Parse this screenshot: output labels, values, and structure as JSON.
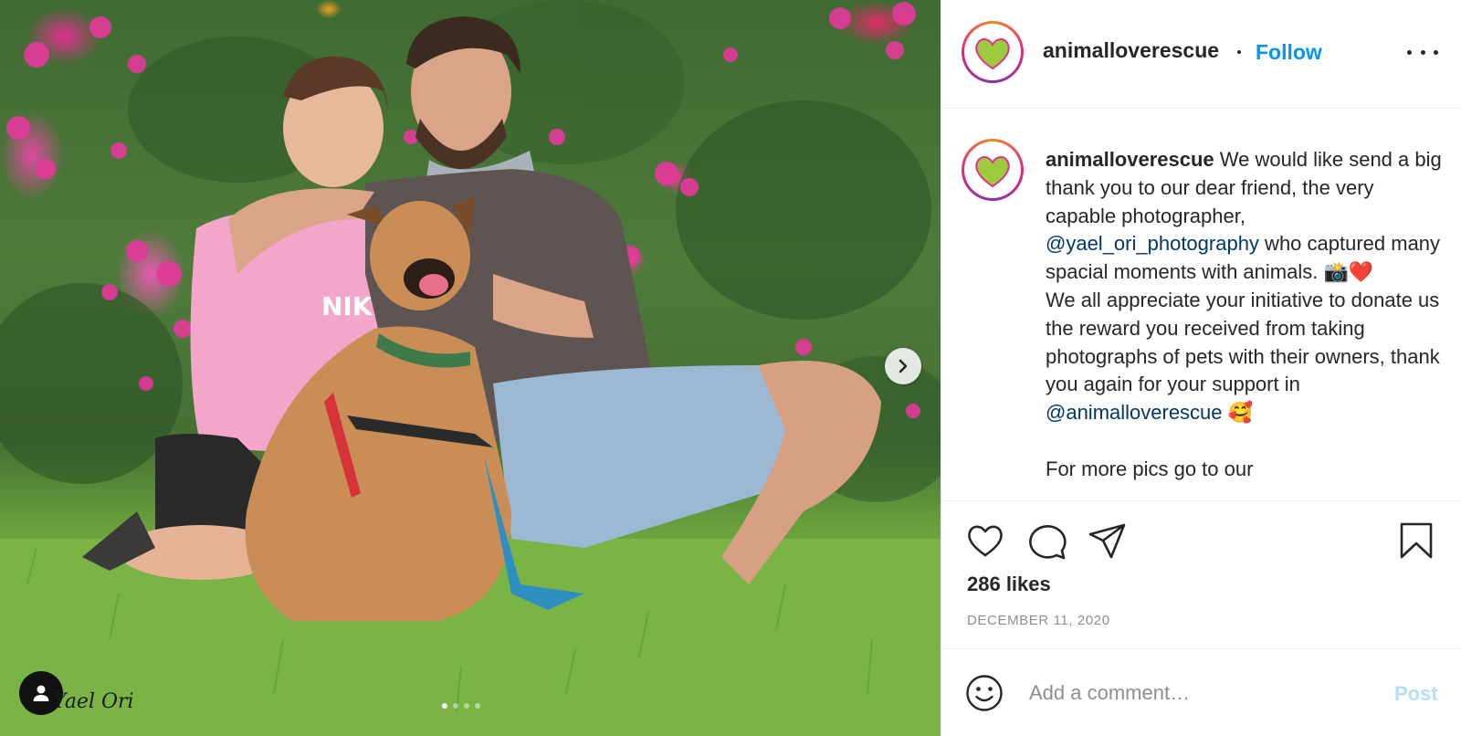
{
  "photo": {
    "watermark": "Yael Ori",
    "carousel_count": 4,
    "carousel_active": 1
  },
  "header": {
    "username": "animalloverescue",
    "follow_label": "Follow"
  },
  "caption": {
    "username": "animalloverescue",
    "line1": " We would like send a big thank you to our dear friend, the very capable photographer, ",
    "mention1": "@yael_ori_photography",
    "line2": " who captured many spacial moments with animals. 📸❤️",
    "line3": "We all appreciate your initiative to donate us the reward you received from taking photographs of pets with their owners, thank you again for your support in ",
    "mention2": "@animalloverescue",
    "line3_end": " 🥰",
    "line4": "For more pics go to our"
  },
  "engagement": {
    "likes": "286 likes",
    "date": "December 11, 2020"
  },
  "comment": {
    "placeholder": "Add a comment…",
    "post_label": "Post"
  },
  "colors": {
    "accent": "#0095f6",
    "post_disabled": "#b2dffc",
    "mention": "#00376b",
    "avatar_heart": "#9ccc3d"
  },
  "icons": [
    "like-icon",
    "comment-icon",
    "share-icon",
    "save-icon",
    "emoji-icon",
    "more-options-icon",
    "chevron-right-icon",
    "user-tag-icon"
  ]
}
